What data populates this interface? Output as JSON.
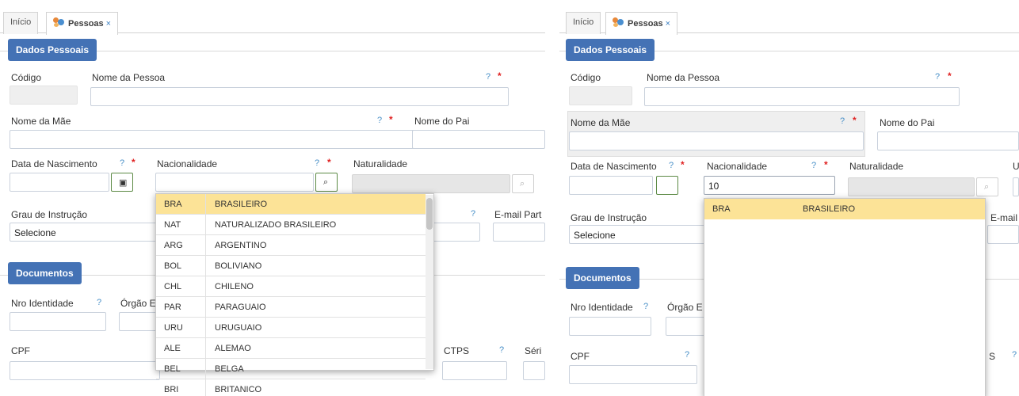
{
  "tabs": {
    "home_label": "Início",
    "active_label": "Pessoas",
    "close_glyph": "×",
    "active_icon": "people-icon"
  },
  "sections": {
    "personal": "Dados Pessoais",
    "documents": "Documentos"
  },
  "labels": {
    "codigo": "Código",
    "nome_pessoa": "Nome da Pessoa",
    "nome_mae": "Nome da Mãe",
    "nome_pai": "Nome do Pai",
    "data_nascimento": "Data de Nascimento",
    "nacionalidade": "Nacionalidade",
    "naturalidade": "Naturalidade",
    "grau_instrucao": "Grau de Instrução",
    "email_parcial": "E-mail Part",
    "email_cut": "E-mail",
    "nro_identidade": "Nro Identidade",
    "orgao": "Órgão E",
    "cpf": "CPF",
    "ctps": "CTPS",
    "serie": "Séri",
    "cut_u": "U",
    "cut_s": "S",
    "help": "?",
    "required": "*"
  },
  "left": {
    "grau_value": "Selecione",
    "nationality_options": [
      {
        "code": "BRA",
        "name": "BRASILEIRO",
        "selected": true
      },
      {
        "code": "NAT",
        "name": "NATURALIZADO BRASILEIRO"
      },
      {
        "code": "ARG",
        "name": "ARGENTINO"
      },
      {
        "code": "BOL",
        "name": "BOLIVIANO"
      },
      {
        "code": "CHL",
        "name": "CHILENO"
      },
      {
        "code": "PAR",
        "name": "PARAGUAIO"
      },
      {
        "code": "URU",
        "name": "URUGUAIO"
      },
      {
        "code": "ALE",
        "name": "ALEMAO"
      },
      {
        "code": "BEL",
        "name": "BELGA"
      },
      {
        "code": "BRI",
        "name": "BRITANICO"
      }
    ]
  },
  "right": {
    "nacionalidade_value": "10",
    "grau_value": "Selecione",
    "nationality_options": [
      {
        "code": "BRA",
        "name": "BRASILEIRO",
        "selected": true
      }
    ]
  },
  "icons": {
    "calendar": "calendar-icon",
    "search": "search-icon",
    "close": "close-icon"
  },
  "colors": {
    "section_header": "#4472b5",
    "selected_row": "#fce397",
    "required": "#e02020",
    "help": "#4a90c8"
  }
}
